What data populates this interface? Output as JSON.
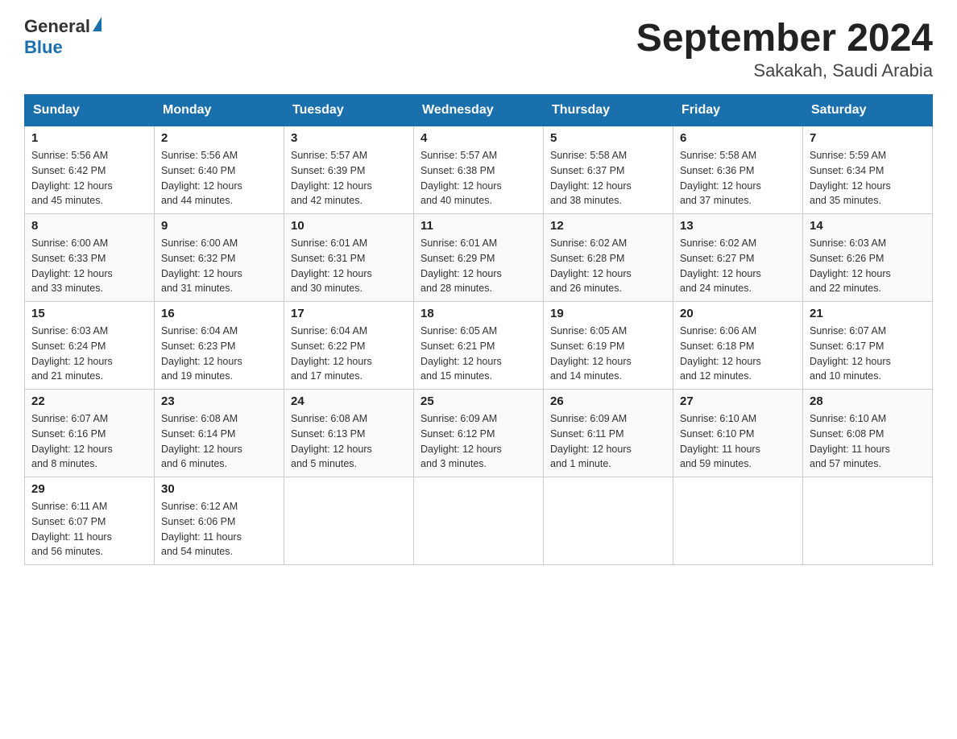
{
  "header": {
    "title": "September 2024",
    "subtitle": "Sakakah, Saudi Arabia",
    "logo_general": "General",
    "logo_blue": "Blue"
  },
  "days_of_week": [
    "Sunday",
    "Monday",
    "Tuesday",
    "Wednesday",
    "Thursday",
    "Friday",
    "Saturday"
  ],
  "weeks": [
    {
      "week_class": "row-week1",
      "days": [
        {
          "number": "1",
          "sunrise": "5:56 AM",
          "sunset": "6:42 PM",
          "daylight": "12 hours and 45 minutes."
        },
        {
          "number": "2",
          "sunrise": "5:56 AM",
          "sunset": "6:40 PM",
          "daylight": "12 hours and 44 minutes."
        },
        {
          "number": "3",
          "sunrise": "5:57 AM",
          "sunset": "6:39 PM",
          "daylight": "12 hours and 42 minutes."
        },
        {
          "number": "4",
          "sunrise": "5:57 AM",
          "sunset": "6:38 PM",
          "daylight": "12 hours and 40 minutes."
        },
        {
          "number": "5",
          "sunrise": "5:58 AM",
          "sunset": "6:37 PM",
          "daylight": "12 hours and 38 minutes."
        },
        {
          "number": "6",
          "sunrise": "5:58 AM",
          "sunset": "6:36 PM",
          "daylight": "12 hours and 37 minutes."
        },
        {
          "number": "7",
          "sunrise": "5:59 AM",
          "sunset": "6:34 PM",
          "daylight": "12 hours and 35 minutes."
        }
      ]
    },
    {
      "week_class": "row-week2",
      "days": [
        {
          "number": "8",
          "sunrise": "6:00 AM",
          "sunset": "6:33 PM",
          "daylight": "12 hours and 33 minutes."
        },
        {
          "number": "9",
          "sunrise": "6:00 AM",
          "sunset": "6:32 PM",
          "daylight": "12 hours and 31 minutes."
        },
        {
          "number": "10",
          "sunrise": "6:01 AM",
          "sunset": "6:31 PM",
          "daylight": "12 hours and 30 minutes."
        },
        {
          "number": "11",
          "sunrise": "6:01 AM",
          "sunset": "6:29 PM",
          "daylight": "12 hours and 28 minutes."
        },
        {
          "number": "12",
          "sunrise": "6:02 AM",
          "sunset": "6:28 PM",
          "daylight": "12 hours and 26 minutes."
        },
        {
          "number": "13",
          "sunrise": "6:02 AM",
          "sunset": "6:27 PM",
          "daylight": "12 hours and 24 minutes."
        },
        {
          "number": "14",
          "sunrise": "6:03 AM",
          "sunset": "6:26 PM",
          "daylight": "12 hours and 22 minutes."
        }
      ]
    },
    {
      "week_class": "row-week3",
      "days": [
        {
          "number": "15",
          "sunrise": "6:03 AM",
          "sunset": "6:24 PM",
          "daylight": "12 hours and 21 minutes."
        },
        {
          "number": "16",
          "sunrise": "6:04 AM",
          "sunset": "6:23 PM",
          "daylight": "12 hours and 19 minutes."
        },
        {
          "number": "17",
          "sunrise": "6:04 AM",
          "sunset": "6:22 PM",
          "daylight": "12 hours and 17 minutes."
        },
        {
          "number": "18",
          "sunrise": "6:05 AM",
          "sunset": "6:21 PM",
          "daylight": "12 hours and 15 minutes."
        },
        {
          "number": "19",
          "sunrise": "6:05 AM",
          "sunset": "6:19 PM",
          "daylight": "12 hours and 14 minutes."
        },
        {
          "number": "20",
          "sunrise": "6:06 AM",
          "sunset": "6:18 PM",
          "daylight": "12 hours and 12 minutes."
        },
        {
          "number": "21",
          "sunrise": "6:07 AM",
          "sunset": "6:17 PM",
          "daylight": "12 hours and 10 minutes."
        }
      ]
    },
    {
      "week_class": "row-week4",
      "days": [
        {
          "number": "22",
          "sunrise": "6:07 AM",
          "sunset": "6:16 PM",
          "daylight": "12 hours and 8 minutes."
        },
        {
          "number": "23",
          "sunrise": "6:08 AM",
          "sunset": "6:14 PM",
          "daylight": "12 hours and 6 minutes."
        },
        {
          "number": "24",
          "sunrise": "6:08 AM",
          "sunset": "6:13 PM",
          "daylight": "12 hours and 5 minutes."
        },
        {
          "number": "25",
          "sunrise": "6:09 AM",
          "sunset": "6:12 PM",
          "daylight": "12 hours and 3 minutes."
        },
        {
          "number": "26",
          "sunrise": "6:09 AM",
          "sunset": "6:11 PM",
          "daylight": "12 hours and 1 minute."
        },
        {
          "number": "27",
          "sunrise": "6:10 AM",
          "sunset": "6:10 PM",
          "daylight": "11 hours and 59 minutes."
        },
        {
          "number": "28",
          "sunrise": "6:10 AM",
          "sunset": "6:08 PM",
          "daylight": "11 hours and 57 minutes."
        }
      ]
    },
    {
      "week_class": "row-week5",
      "days": [
        {
          "number": "29",
          "sunrise": "6:11 AM",
          "sunset": "6:07 PM",
          "daylight": "11 hours and 56 minutes."
        },
        {
          "number": "30",
          "sunrise": "6:12 AM",
          "sunset": "6:06 PM",
          "daylight": "11 hours and 54 minutes."
        },
        null,
        null,
        null,
        null,
        null
      ]
    }
  ],
  "labels": {
    "sunrise": "Sunrise:",
    "sunset": "Sunset:",
    "daylight": "Daylight:"
  }
}
